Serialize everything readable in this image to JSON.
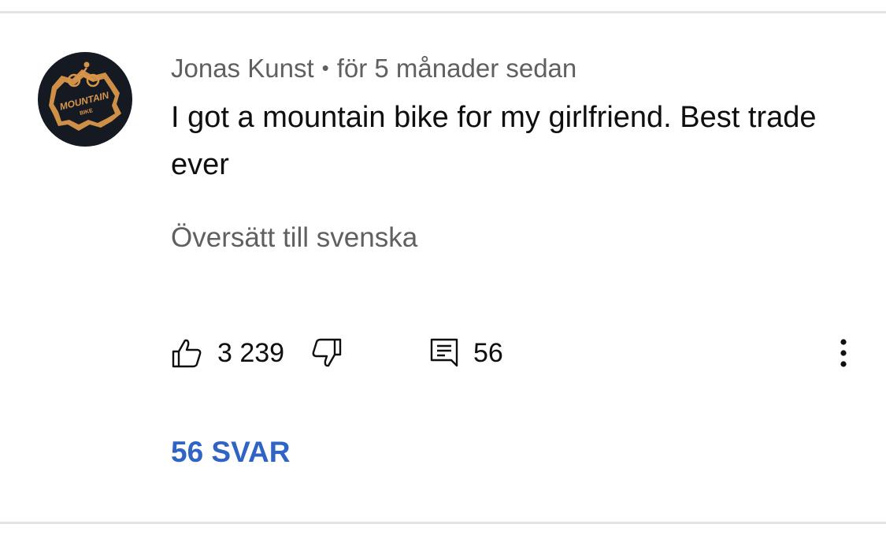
{
  "comment": {
    "author": "Jonas Kunst",
    "separator": "•",
    "timestamp": "för 5 månader sedan",
    "text": "I got a mountain bike for my girlfriend. Best trade ever",
    "translate_label": "Översätt till svenska"
  },
  "actions": {
    "like_count": "3 239",
    "reply_count": "56"
  },
  "replies": {
    "label": "56 SVAR"
  },
  "avatar": {
    "line1": "MOUNTAIN",
    "line2": "BIKE"
  },
  "colors": {
    "text_primary": "#0f0f0f",
    "text_secondary": "#606060",
    "link": "#2f63c4",
    "avatar_bg": "#151a22",
    "avatar_accent": "#d9964a"
  },
  "icons": [
    "thumb-up-icon",
    "thumb-down-icon",
    "comment-icon",
    "more-vert-icon"
  ]
}
